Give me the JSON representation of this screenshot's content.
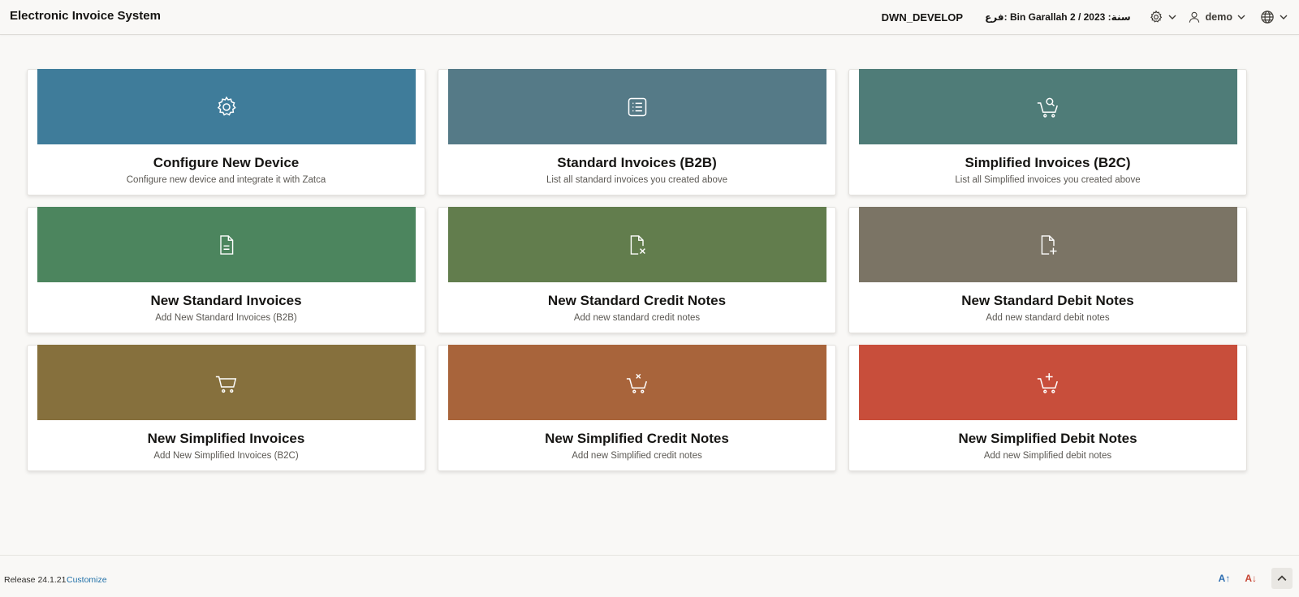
{
  "header": {
    "app_title": "Electronic Invoice System",
    "environment": "DWN_DEVELOP",
    "branch_info": "فرع: Bin Garallah 2 / 2023 :سنة",
    "user_label": "demo",
    "settings_icon": "gear-icon",
    "user_icon": "user-icon",
    "language_icon": "globe-icon"
  },
  "cards": [
    {
      "title": "Configure New Device",
      "subtitle": "Configure new device and integrate it with Zatca",
      "color": "#3f7c9a",
      "icon": "gear-icon"
    },
    {
      "title": "Standard Invoices (B2B)",
      "subtitle": "List all standard invoices you created above",
      "color": "#557a87",
      "icon": "list-icon"
    },
    {
      "title": "Simplified Invoices (B2C)",
      "subtitle": "List all Simplified invoices you created above",
      "color": "#4f7c78",
      "icon": "cart-search-icon"
    },
    {
      "title": "New Standard Invoices",
      "subtitle": "Add New Standard Invoices (B2B)",
      "color": "#4c855e",
      "icon": "document-icon"
    },
    {
      "title": "New Standard Credit Notes",
      "subtitle": "Add new standard credit notes",
      "color": "#627d4d",
      "icon": "document-x-icon"
    },
    {
      "title": "New Standard Debit Notes",
      "subtitle": "Add new standard debit notes",
      "color": "#7b7465",
      "icon": "document-plus-icon"
    },
    {
      "title": "New Simplified Invoices",
      "subtitle": "Add New Simplified Invoices (B2C)",
      "color": "#86703d",
      "icon": "cart-icon"
    },
    {
      "title": "New Simplified Credit Notes",
      "subtitle": "Add new Simplified credit notes",
      "color": "#a8643b",
      "icon": "cart-x-icon"
    },
    {
      "title": "New Simplified Debit Notes",
      "subtitle": "Add new Simplified debit notes",
      "color": "#c84e3b",
      "icon": "cart-plus-icon"
    }
  ],
  "footer": {
    "release": "Release 24.1.21",
    "customize": "Customize",
    "increase_font_label": "A↑",
    "decrease_font_label": "A↓"
  }
}
